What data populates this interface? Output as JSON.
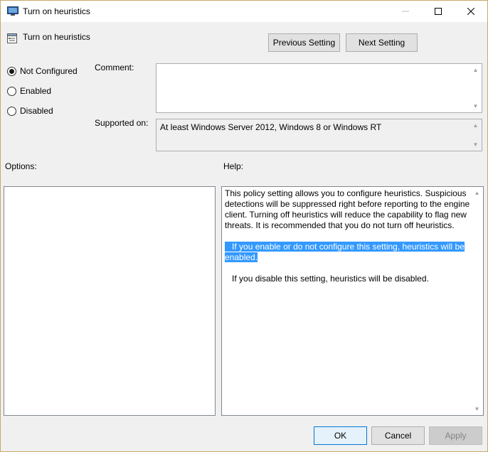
{
  "window": {
    "title": "Turn on heuristics"
  },
  "header": {
    "title": "Turn on heuristics",
    "prev_label": "Previous Setting",
    "next_label": "Next Setting"
  },
  "state": {
    "options": [
      {
        "label": "Not Configured",
        "checked": true
      },
      {
        "label": "Enabled",
        "checked": false
      },
      {
        "label": "Disabled",
        "checked": false
      }
    ]
  },
  "comment": {
    "label": "Comment:",
    "value": ""
  },
  "supported": {
    "label": "Supported on:",
    "value": "At least Windows Server 2012, Windows 8 or Windows RT"
  },
  "options_panel": {
    "label": "Options:"
  },
  "help": {
    "label": "Help:",
    "paragraph1": "This policy setting allows you to configure heuristics. Suspicious detections will be suppressed right before reporting to the engine client. Turning off heuristics will reduce the capability to flag new threats. It is recommended that you do not turn off heuristics.",
    "paragraph2": "If you enable or do not configure this setting, heuristics will be enabled.",
    "paragraph3": "If you disable this setting, heuristics will be disabled."
  },
  "footer": {
    "ok_label": "OK",
    "cancel_label": "Cancel",
    "apply_label": "Apply"
  },
  "colors": {
    "selection": "#3399ff",
    "ok_border": "#0078d7"
  },
  "icons": {
    "title": "policy-window-icon",
    "header": "policy-setting-icon"
  }
}
